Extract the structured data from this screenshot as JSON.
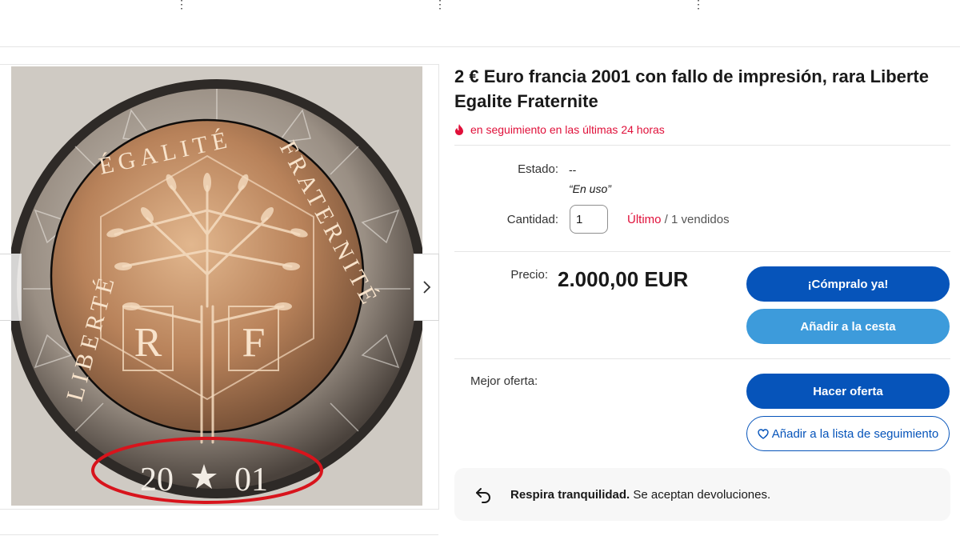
{
  "listing": {
    "title": "2 € Euro francia 2001 con fallo de impresión, rara Liberte Egalite Fraternite",
    "watch_text": "en seguimiento en las últimas 24 horas",
    "condition_label": "Estado:",
    "condition_value": "--",
    "condition_note": "“En uso”",
    "quantity_label": "Cantidad:",
    "quantity_value": "1",
    "last_label": "Último",
    "sold_text": " / 1 vendidos",
    "price_label": "Precio:",
    "price_value": "2.000,00 EUR",
    "buy_now": "¡Cómpralo ya!",
    "add_to_cart": "Añadir a la cesta",
    "best_offer_label": "Mejor oferta:",
    "make_offer": "Hacer oferta",
    "add_to_watchlist": "Añadir a la lista de seguimiento",
    "returns_bold": "Respira tranquilidad.",
    "returns_text": " Se aceptan devoluciones."
  },
  "coin_image": {
    "left_legend": "LIBERTÉ",
    "top_legend": "ÉGALITÉ",
    "right_legend": "FRATERNITÉ",
    "letters_left": "R",
    "letters_right": "F",
    "year_left": "20",
    "year_right": "01"
  },
  "colors": {
    "primary_button": "#0654ba",
    "secondary_button": "#3d9bdb",
    "urgency_red": "#e0103a",
    "annotation_red": "#d8141c"
  },
  "icons": {
    "watch": "flame-icon",
    "next": "chevron-right-icon",
    "watchlist": "heart-icon",
    "returns": "return-arrow-icon"
  }
}
